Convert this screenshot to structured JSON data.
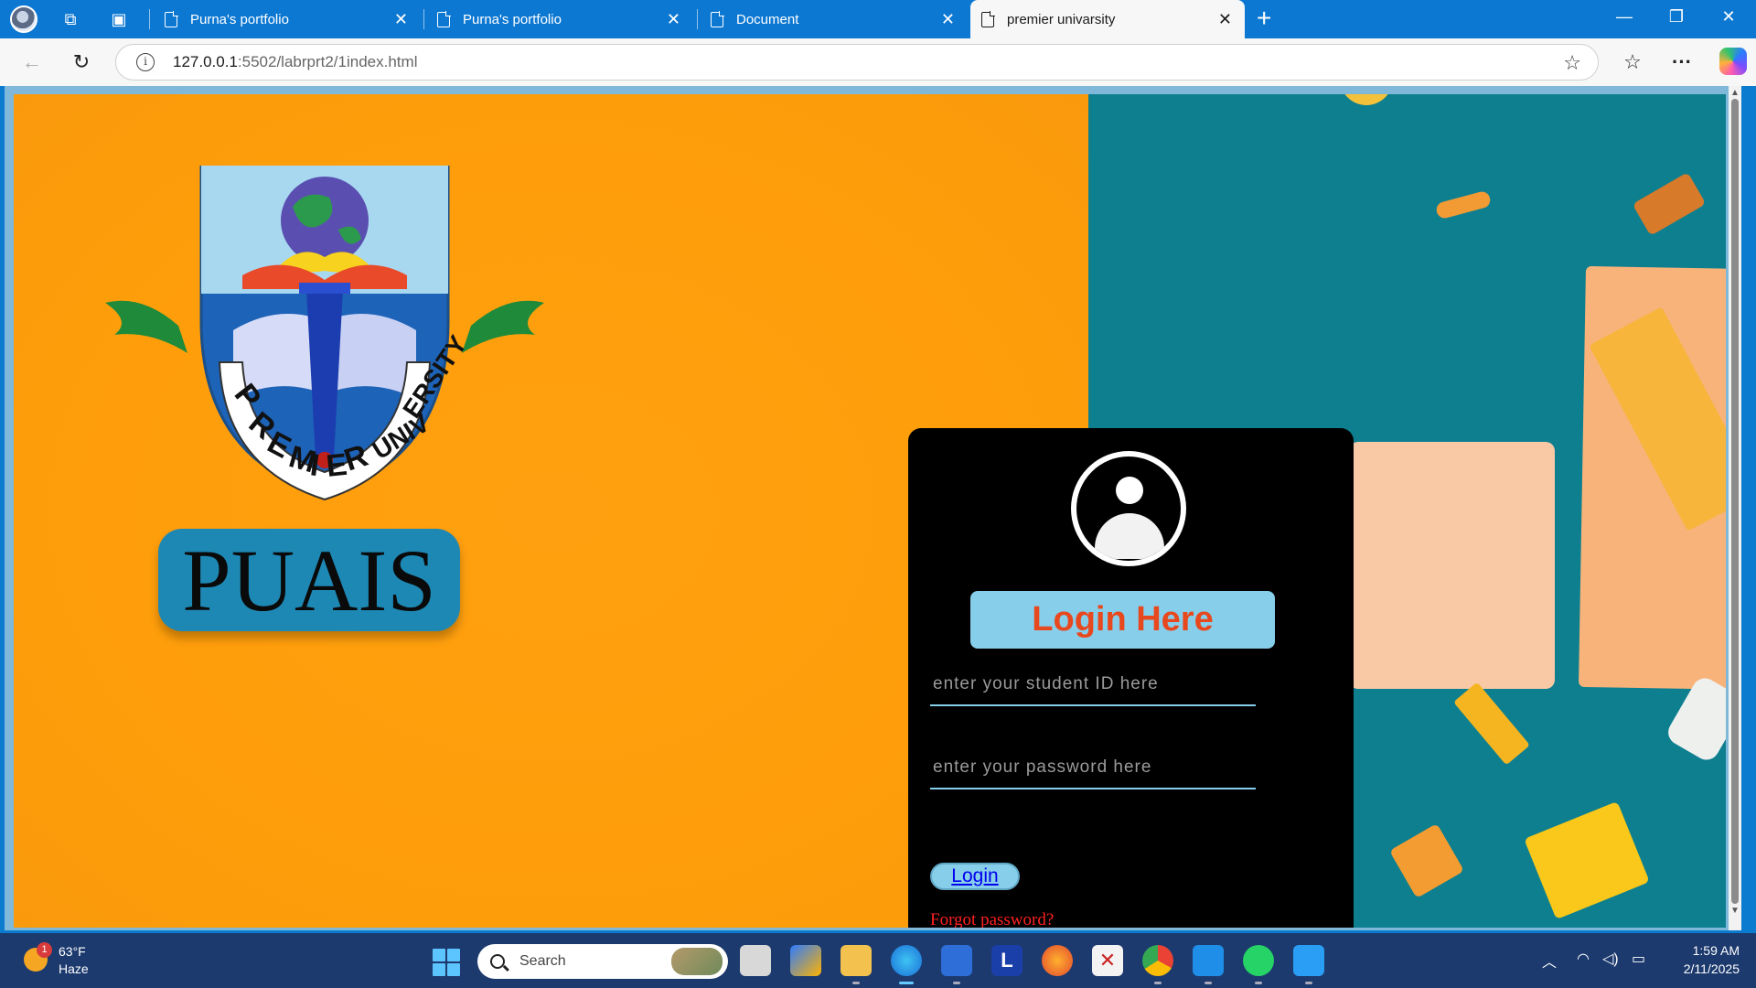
{
  "browser": {
    "tabs": [
      {
        "label": "Purna's portfolio",
        "active": false
      },
      {
        "label": "Purna's portfolio",
        "active": false
      },
      {
        "label": "Document",
        "active": false
      },
      {
        "label": "premier univarsity",
        "active": true
      }
    ],
    "url_host": "127.0.0.1",
    "url_rest": ":5502/labrprt2/1index.html"
  },
  "page": {
    "logo_alt": "PREMIER UNIVERSITY",
    "brand": "PUAIS",
    "login_title": "Login Here",
    "student_id_placeholder": "enter your student ID here",
    "password_placeholder": "enter your password here",
    "login_button": "Login",
    "forgot_link": "Forgot password?",
    "colors": {
      "left_bg": "#ff9e0a",
      "right_bg": "#0d7f8f",
      "card_bg": "#000000",
      "accent": "#87ceeb",
      "title_text": "#e8481e",
      "forgot_text": "#ff2020"
    }
  },
  "taskbar": {
    "weather_temp": "63°F",
    "weather_cond": "Haze",
    "weather_badge": "1",
    "search_label": "Search",
    "time": "1:59 AM",
    "date": "2/11/2025"
  }
}
